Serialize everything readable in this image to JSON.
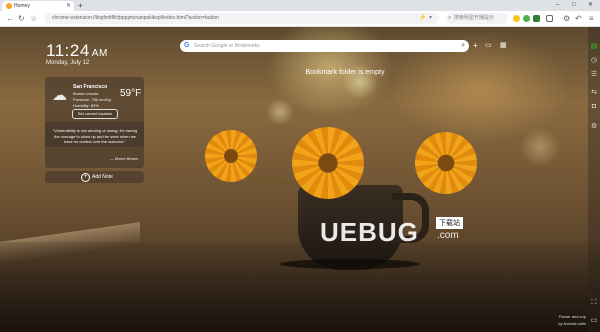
{
  "browser": {
    "tab_title": "Homey",
    "new_tab": "+",
    "url": "chrome-extension://ilnjdmfiflfcfpppjmcnanpokikcpl/index.html?action=button",
    "search_box_placeholder": "搜索明星开播提示",
    "window_controls": [
      "‒",
      "□",
      "✕"
    ]
  },
  "clock": {
    "time": "11:24",
    "ampm": "AM",
    "date": "Monday, July 12"
  },
  "weather": {
    "city": "San Francisco",
    "condition": "Broken clouds",
    "pressure": "Pressure: 758 mmHg",
    "humidity": "Humidity: 83%",
    "temp": "59°F",
    "button": "Set current location"
  },
  "quote": {
    "text": "\"Vulnerability is not winning or losing; it's having the courage to show up and be seen when we have no control over the outcome.\"",
    "author": "— Brene Brown"
  },
  "add_note": {
    "label": "Add Note"
  },
  "search": {
    "placeholder": "Search Google or Bookmarks"
  },
  "bookmarks": {
    "empty_message": "Bookmark folder is empty"
  },
  "watermark": {
    "logo": "UEBUG",
    "badge": "下载站",
    "suffix": ".com"
  },
  "credit": {
    "line1": "Flower and cup",
    "line2": "by Avinash.lathi"
  },
  "icons": {
    "search": "magnifier-icon",
    "add": "plus-icon",
    "image": "image-icon",
    "grid": "grid-icon"
  }
}
